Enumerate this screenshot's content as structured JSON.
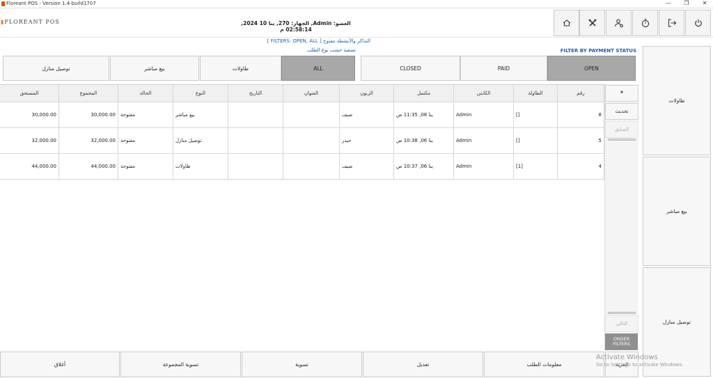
{
  "window": {
    "title": "Floreant POS - Version 1.4-build1707",
    "controls": [
      "—",
      "❐",
      "✕"
    ]
  },
  "header": {
    "brand": "FLOREANT POS",
    "session": "العضو: Admin, الجهاز: 270, ينا 10 2024, 02:58:14 م",
    "buttons": [
      {
        "name": "home-icon"
      },
      {
        "name": "tools-icon"
      },
      {
        "name": "user-settings-icon"
      },
      {
        "name": "clock-icon"
      },
      {
        "name": "logout-icon"
      },
      {
        "name": "power-icon"
      }
    ]
  },
  "filters": {
    "title": "التذاكر والأنشطة مفتوح [ FILTERS: OPEN, ALL ]",
    "order_type_label": "تصفية حسب نوع الطلب",
    "payment_status_label": "FILTER BY PAYMENT STATUS",
    "order_types": [
      "توصيل منازل",
      "بيع مباشر",
      "طاولات",
      "ALL"
    ],
    "order_type_selected": "ALL",
    "payment_statuses": [
      "CLOSED",
      "PAID",
      "OPEN"
    ],
    "payment_status_selected": "OPEN"
  },
  "table": {
    "columns": [
      "المستحق",
      "المجموع",
      "الحالة",
      "النوع",
      "التاريخ",
      "العنوان",
      "الزبون",
      "مكتمل",
      "الكابتن",
      "الطاولة",
      "رقم"
    ],
    "rows": [
      [
        "30,000.00",
        "30,000.00",
        "مفتوحة",
        "بيع مباشر",
        "",
        "",
        "ضيف",
        "ينا 08, 11:35 ص",
        "Admin",
        "[]",
        "8"
      ],
      [
        "32,000.00",
        "32,000.00",
        "مفتوحة",
        "توصيل منازل",
        "",
        "",
        "حيدر",
        "ينا 06, 10:38 ص",
        "Admin",
        "[]",
        "5"
      ],
      [
        "44,000.00",
        "44,000.00",
        "مفتوحة",
        "طاولات",
        "",
        "",
        "ضيف",
        "ينا 06, 10:37 ص",
        "Admin",
        "[1]",
        "4"
      ]
    ]
  },
  "side_controls": {
    "star": "*",
    "refresh": "تحديث",
    "previous": "السابق",
    "next": "التالي",
    "order_filters": "ORDER FILTERS",
    "more": "المزيد"
  },
  "right_panel": [
    "طاولات",
    "بيع مباشر",
    "توصيل منازل"
  ],
  "bottom_actions": [
    "أغلاق",
    "تسوية المجموعة",
    "تسوية",
    "تعديل",
    "معلومات الطلب"
  ],
  "watermark": {
    "title": "Activate Windows",
    "subtitle": "Go to Settings to activate Windows."
  }
}
